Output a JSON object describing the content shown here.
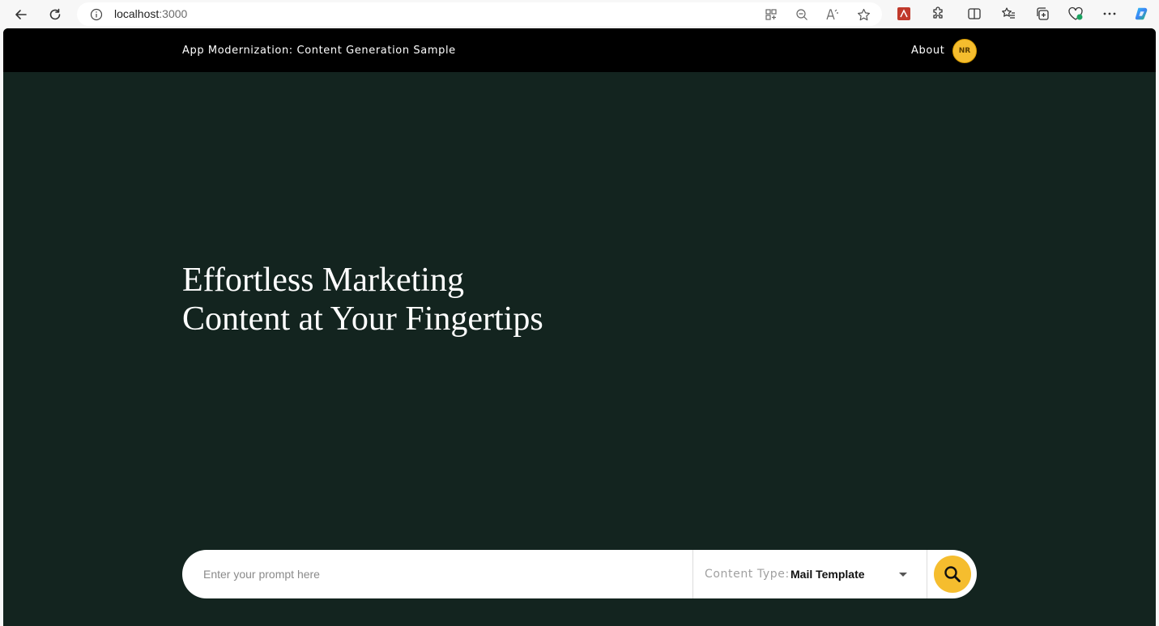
{
  "browser": {
    "url_host": "localhost",
    "url_port": ":3000",
    "icons": [
      "back-icon",
      "refresh-icon",
      "info-icon",
      "apps-icon",
      "zoom-out-icon",
      "read-aloud-icon",
      "favorite-star-icon",
      "extension-red-icon",
      "extensions-icon",
      "split-screen-icon",
      "favorites-icon",
      "collections-icon",
      "browser-essentials-icon",
      "more-icon",
      "copilot-icon"
    ]
  },
  "header": {
    "title": "App Modernization: Content Generation Sample",
    "about_label": "About",
    "avatar_initials": "NR"
  },
  "hero": {
    "line1": "Effortless Marketing",
    "line2": "Content at Your Fingertips"
  },
  "prompt": {
    "placeholder": "Enter your prompt here",
    "value": "",
    "content_type_label": "Content Type:",
    "content_type_value": "Mail Template"
  },
  "colors": {
    "background": "#13241f",
    "header": "#000000",
    "accent": "#f5bd2e"
  }
}
